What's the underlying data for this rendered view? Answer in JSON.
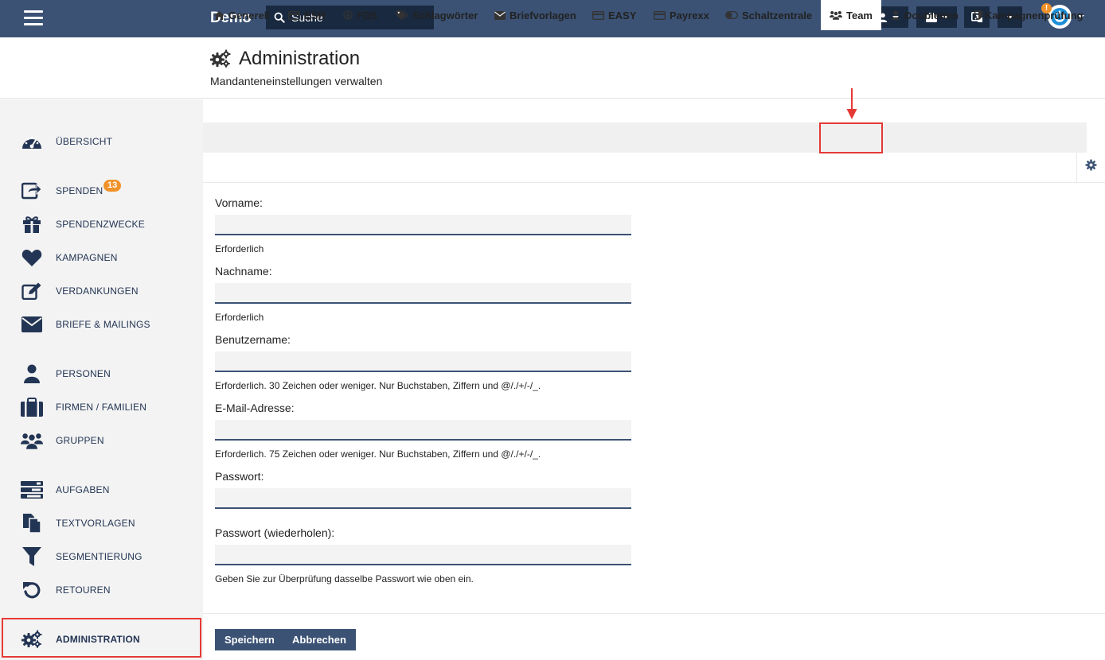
{
  "topbar": {
    "brand": "Demo",
    "search_placeholder": "Suche",
    "notification_badge": "!"
  },
  "header": {
    "title": "Administration",
    "subtitle": "Mandanteneinstellungen verwalten"
  },
  "sidebar": {
    "items": [
      {
        "label": "ÜBERSICHT",
        "icon": "dashboard-icon"
      },
      {
        "label": "SPENDEN",
        "icon": "donation-share-icon",
        "badge": "13"
      },
      {
        "label": "SPENDENZWECKE",
        "icon": "gift-icon"
      },
      {
        "label": "KAMPAGNEN",
        "icon": "heart-icon"
      },
      {
        "label": "VERDANKUNGEN",
        "icon": "edit-icon"
      },
      {
        "label": "BRIEFE & MAILINGS",
        "icon": "envelope-icon"
      },
      {
        "label": "PERSONEN",
        "icon": "user-icon"
      },
      {
        "label": "FIRMEN / FAMILIEN",
        "icon": "briefcase-icon"
      },
      {
        "label": "GRUPPEN",
        "icon": "users-icon"
      },
      {
        "label": "AUFGABEN",
        "icon": "tasks-icon"
      },
      {
        "label": "TEXTVORLAGEN",
        "icon": "copy-icon"
      },
      {
        "label": "SEGMENTIERUNG",
        "icon": "filter-icon"
      },
      {
        "label": "RETOUREN",
        "icon": "undo-icon"
      },
      {
        "label": "ADMINISTRATION",
        "icon": "cogs-icon",
        "active": true
      }
    ]
  },
  "tabs": [
    {
      "label": "Generell",
      "icon": "home-icon"
    },
    {
      "label": "ESR",
      "icon": "credit-card-icon"
    },
    {
      "label": "FDS",
      "icon": "arrow-circle-icon"
    },
    {
      "label": "Schlagwörter",
      "icon": "tags-icon"
    },
    {
      "label": "Briefvorlagen",
      "icon": "envelope-icon"
    },
    {
      "label": "EASY",
      "icon": "credit-card-icon"
    },
    {
      "label": "Payrexx",
      "icon": "credit-card-icon"
    },
    {
      "label": "Schaltzentrale",
      "icon": "toggle-icon"
    },
    {
      "label": "Team",
      "icon": "users-icon",
      "active": true
    },
    {
      "label": "Doubletten",
      "icon": "user-icon"
    },
    {
      "label": "Kampagnenprüfung",
      "icon": "shield-icon"
    }
  ],
  "form": {
    "fields": [
      {
        "label": "Vorname:",
        "value": "",
        "help": "Erforderlich"
      },
      {
        "label": "Nachname:",
        "value": "",
        "help": "Erforderlich"
      },
      {
        "label": "Benutzername:",
        "value": "",
        "help": "Erforderlich. 30 Zeichen oder weniger. Nur Buchstaben, Ziffern und @/./+/-/_."
      },
      {
        "label": "E-Mail-Adresse:",
        "value": "",
        "help": "Erforderlich. 75 Zeichen oder weniger. Nur Buchstaben, Ziffern und @/./+/-/_."
      },
      {
        "label": "Passwort:",
        "value": "",
        "help": ""
      },
      {
        "label": "Passwort (wiederholen):",
        "value": "",
        "help": "Geben Sie zur Überprüfung dasselbe Passwort wie oben ein."
      }
    ],
    "save_label": "Speichern",
    "cancel_label": "Abbrechen"
  },
  "colors": {
    "topbar": "#3b5275",
    "topbar_dark": "#192940",
    "accent_orange": "#f0922a",
    "highlight_red": "#e53935",
    "nav_text": "#233554"
  }
}
